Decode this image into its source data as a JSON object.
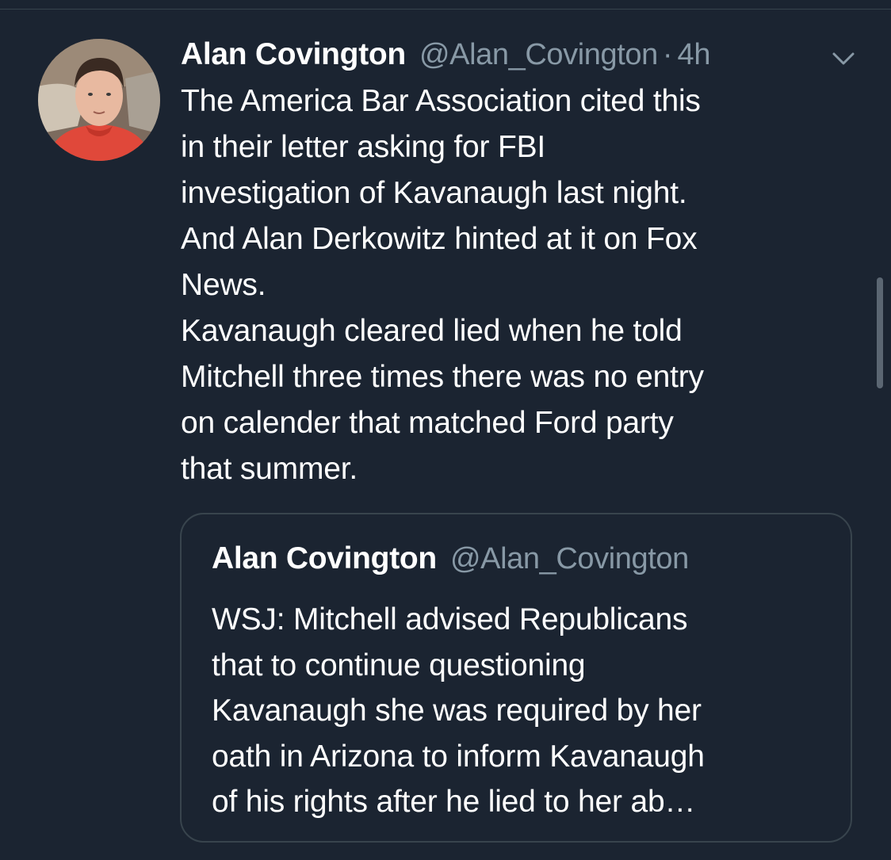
{
  "tweet": {
    "author_name": "Alan Covington",
    "author_handle": "@Alan_Covington",
    "separator": "·",
    "timestamp": "4h",
    "menu_icon": "chevron-down-icon",
    "lines": [
      "The America Bar Association cited this",
      "in their letter asking for FBI",
      "investigation of Kavanaugh last night.",
      "And Alan Derkowitz hinted at it on Fox",
      "News.",
      "Kavanaugh cleared lied when he told",
      "Mitchell three times there was no entry",
      "on calender that matched Ford party",
      "that summer."
    ]
  },
  "quoted_tweet": {
    "author_name": "Alan Covington",
    "author_handle": "@Alan_Covington",
    "lines": [
      "WSJ: Mitchell advised Republicans",
      "that to continue questioning",
      "Kavanaugh she was required by her",
      "oath in Arizona to inform Kavanaugh",
      "of his rights after he lied to her ab…"
    ]
  },
  "colors": {
    "background": "#1b2431",
    "text_primary": "#ffffff",
    "text_secondary": "#8899a6",
    "border": "#38444d"
  }
}
